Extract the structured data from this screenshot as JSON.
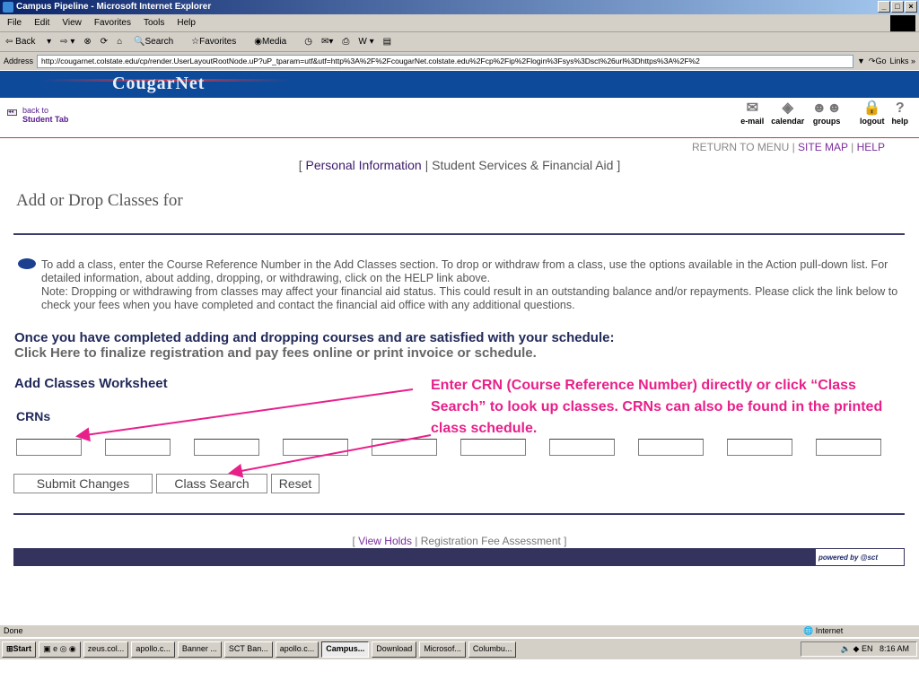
{
  "window": {
    "title": "Campus Pipeline - Microsoft Internet Explorer"
  },
  "menu": [
    "File",
    "Edit",
    "View",
    "Favorites",
    "Tools",
    "Help"
  ],
  "toolbar": {
    "back": "Back",
    "search": "Search",
    "favorites": "Favorites",
    "media": "Media"
  },
  "address": {
    "label": "Address",
    "url": "http://cougarnet.colstate.edu/cp/render.UserLayoutRootNode.uP?uP_tparam=utf&utf=http%3A%2F%2FcougarNet.colstate.edu%2Fcp%2Fip%2Flogin%3Fsys%3Dsct%26url%3Dhttps%3A%2F%2",
    "go": "Go",
    "links": "Links"
  },
  "header": {
    "logo": "CougarNet",
    "back_line1": "back to",
    "back_line2": "Student Tab",
    "icons": [
      {
        "label": "e-mail",
        "icon": "envelope-icon"
      },
      {
        "label": "calendar",
        "icon": "calendar-icon"
      },
      {
        "label": "groups",
        "icon": "groups-icon"
      },
      {
        "label": "logout",
        "icon": "lock-icon"
      },
      {
        "label": "help",
        "icon": "question-icon"
      }
    ]
  },
  "toplinks": {
    "return": "RETURN TO MENU",
    "sitemap": "SITE MAP",
    "help": "HELP"
  },
  "tabs": {
    "personal": "Personal Information",
    "student": "Student Services & Financial Aid"
  },
  "page": {
    "title": "Add or Drop Classes for",
    "info1": "To add a class, enter the Course Reference Number in the Add Classes section. To drop or withdraw from a class, use the options available in the Action pull-down list. For detailed information, about adding, dropping, or withdrawing, click on the HELP link above.",
    "info2": "Note: Dropping or withdrawing from classes may affect your financial aid status. This could result in an outstanding balance and/or repayments. Please click the link below to check your fees when you have completed and contact the financial aid office with any additional questions.",
    "once": "Once you have completed adding and dropping courses and are satisfied with your schedule:",
    "click": "Click Here to finalize registration and pay fees online or print invoice or schedule.",
    "worksheet": "Add Classes Worksheet",
    "crns": "CRNs",
    "crn_values": [
      "",
      "",
      "",
      "",
      "",
      "",
      "",
      "",
      "",
      ""
    ],
    "submit": "Submit Changes",
    "class_search": "Class Search",
    "reset": "Reset",
    "callout": "Enter CRN (Course Reference Number) directly or click “Class Search” to look up classes. CRNs can also be found in the printed class schedule.",
    "callout_color": "#e8208a"
  },
  "footer": {
    "holds": "View Holds",
    "fee": "Registration Fee Assessment",
    "powered": "powered by @sct"
  },
  "status": {
    "text": "Done",
    "zone": "Internet"
  },
  "taskbar": {
    "start": "Start",
    "items": [
      "zeus.col...",
      "apollo.c...",
      "Banner ...",
      "SCT Ban...",
      "apollo.c...",
      "Campus...",
      "Download",
      "Microsof...",
      "Columbu..."
    ],
    "active_index": 5,
    "clock": "8:16 AM",
    "lang": "EN"
  }
}
